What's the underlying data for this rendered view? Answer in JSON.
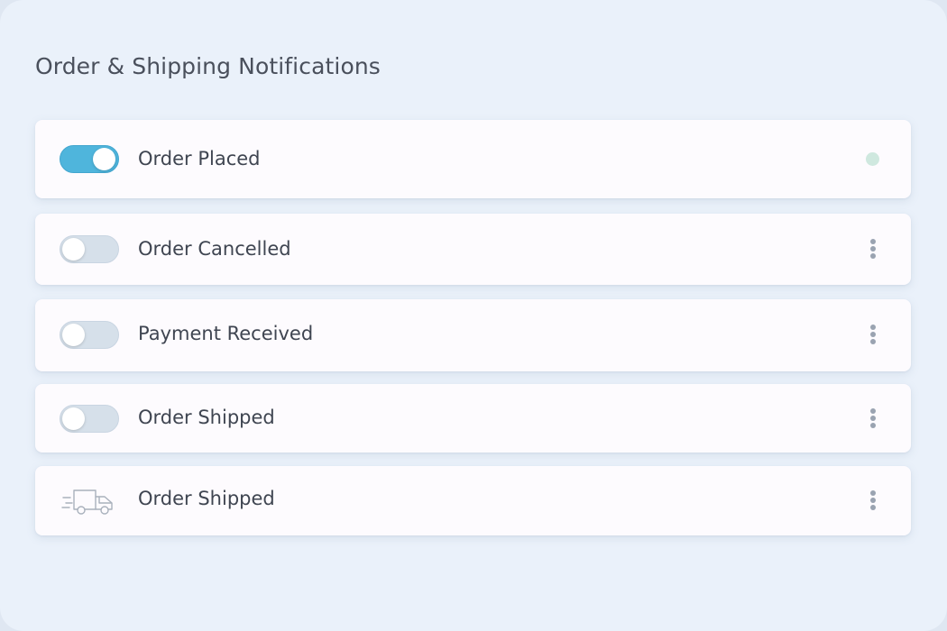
{
  "panel": {
    "title": "Order & Shipping Notifications"
  },
  "colors": {
    "toggle_on": "#4fb5dc",
    "toggle_off": "#d6e0ea",
    "status_dot": "#cfe8df"
  },
  "notifications": [
    {
      "label": "Order Placed",
      "enabled": true,
      "control": "toggle",
      "trailing": "status-dot"
    },
    {
      "label": "Order Cancelled",
      "enabled": false,
      "control": "toggle",
      "trailing": "more-icon"
    },
    {
      "label": "Payment Received",
      "enabled": false,
      "control": "toggle",
      "trailing": "more-icon"
    },
    {
      "label": "Order Shipped",
      "enabled": false,
      "control": "toggle",
      "trailing": "more-icon"
    },
    {
      "label": "Order Shipped",
      "control": "truck-icon",
      "trailing": "more-icon"
    }
  ]
}
